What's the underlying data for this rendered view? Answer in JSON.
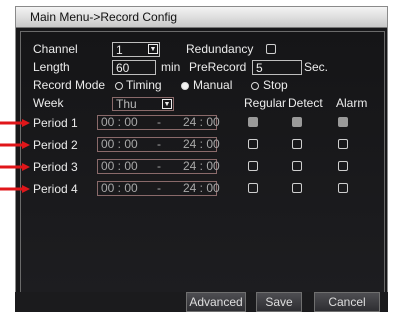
{
  "window": {
    "title": "Main Menu->Record Config"
  },
  "channel": {
    "label": "Channel",
    "value": "1"
  },
  "redundancy": {
    "label": "Redundancy",
    "checked": false
  },
  "length": {
    "label": "Length",
    "value": "60",
    "unit": "min"
  },
  "prerecord": {
    "label": "PreRecord",
    "value": "5",
    "unit": "Sec."
  },
  "record_mode": {
    "label": "Record Mode",
    "options": [
      "Timing",
      "Manual",
      "Stop"
    ],
    "selected": "Manual"
  },
  "week": {
    "label": "Week",
    "value": "Thu"
  },
  "columns": {
    "regular": "Regular",
    "detect": "Detect",
    "alarm": "Alarm"
  },
  "periods": [
    {
      "label": "Period 1",
      "start": "00 : 00",
      "sep": "-",
      "end": "24 : 00",
      "regular": true,
      "detect": true,
      "alarm": true
    },
    {
      "label": "Period 2",
      "start": "00 : 00",
      "sep": "-",
      "end": "24 : 00",
      "regular": false,
      "detect": false,
      "alarm": false
    },
    {
      "label": "Period 3",
      "start": "00 : 00",
      "sep": "-",
      "end": "24 : 00",
      "regular": false,
      "detect": false,
      "alarm": false
    },
    {
      "label": "Period 4",
      "start": "00 : 00",
      "sep": "-",
      "end": "24 : 00",
      "regular": false,
      "detect": false,
      "alarm": false
    }
  ],
  "buttons": {
    "advanced": "Advanced",
    "save": "Save",
    "cancel": "Cancel"
  },
  "colors": {
    "annotation_arrow": "#e0161a",
    "checked_box": "#9a9a9a"
  }
}
